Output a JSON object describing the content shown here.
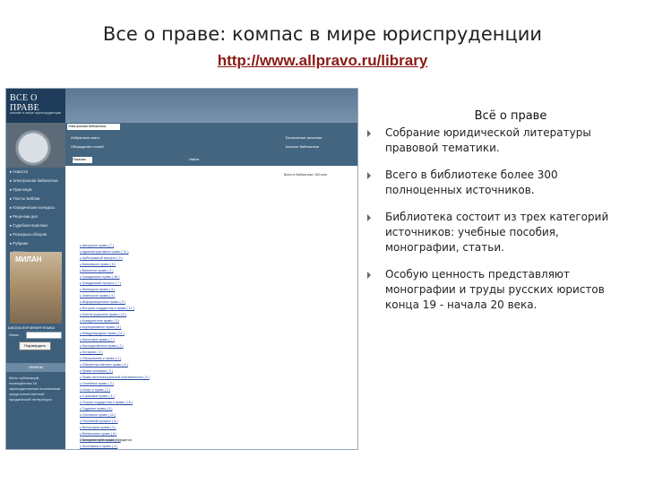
{
  "slide": {
    "title": "Все  о  праве: компас в мире юриспруденции",
    "url": "http://www.allpravo.ru/library"
  },
  "site": {
    "logo_title": "ВСЕ О ПРАВЕ",
    "logo_subtitle": "компас в мире юриспруденции",
    "menu": [
      "Новости",
      "Электронная библиотека",
      "Практикум",
      "Тексты Библии",
      "Юридические конкурсы",
      "Рецензии дня",
      "Судебная практика",
      "Розыгрыш обзоров",
      "Рубрики",
      "Опросы"
    ],
    "ad_title": "МИЛАН",
    "ad_caption": "ШКОЛА ИЗУЧЕНИЯ ЯЗЫКА",
    "login_label": "Логин",
    "password_label": "Пароль",
    "login_button": "Подтвердить",
    "news_heading": "Анонсы",
    "news_text": "Мало публикаций, посвящённых 18 законодательным положениям среди отечественной юридической литературы",
    "crumb": "Электронная библиотека",
    "top_links": [
      "Избранные книги",
      "Бесплатные решения",
      "Обсуждение статей",
      "Каталог библиотеки"
    ],
    "select_value": "Показать",
    "go_label": "Найти",
    "stats_line": "Всего в библиотеке: 300 книг",
    "categories": [
      "Авторское право ( 7 )",
      "Административное право ( 11 )",
      "Арбитражный процесс ( 9 )",
      "Банковское право ( 5 )",
      "Валютное право ( 2 )",
      "Гражданское право ( 46 )",
      "Гражданский процесс ( 7 )",
      "Жилищное право ( 3 )",
      "Земельное право ( 4 )",
      "Информационное право ( 5 )",
      "История государства и права ( 17 )",
      "Конституционное право ( 12 )",
      "Конкурентное право ( 3 )",
      "Корпоративное право ( 6 )",
      "Международное право ( 11 )",
      "Налоговое право ( 7 )",
      "Наследственное право ( 2 )",
      "Нотариат ( 3 )",
      "Образование и право ( 4 )",
      "Обязательственное право ( 5 )",
      "Права человека ( 3 )",
      "Право интеллектуальной собственности ( 6 )",
      "Семейное право ( 3 )",
      "Спорт и право ( 2 )",
      "Страховое право ( 4 )",
      "Теория государства и права ( 15 )",
      "Трудовое право ( 5 )",
      "Уголовное право ( 12 )",
      "Уголовный процесс ( 8 )",
      "Философия права ( 3 )",
      "Финансовое право ( 6 )",
      "Экологическое право ( 3 )",
      "Экономика и право ( 4 )",
      "Юридическая техника ( 2 )",
      "Юридическая психология ( 3 )",
      "Юридический английский ( 2 )"
    ],
    "footer_note": "Последние публикации в разделах"
  },
  "content": {
    "heading": "Всё о праве",
    "bullets": [
      "Собрание юридической литературы правовой тематики.",
      "Всего в библиотеке более 300 полноценных источников.",
      "Библиотека состоит из трех категорий источников: учебные пособия, монографии, статьи.",
      "Особую ценность представляют монографии и труды русских юристов конца 19 - начала 20 века."
    ]
  }
}
